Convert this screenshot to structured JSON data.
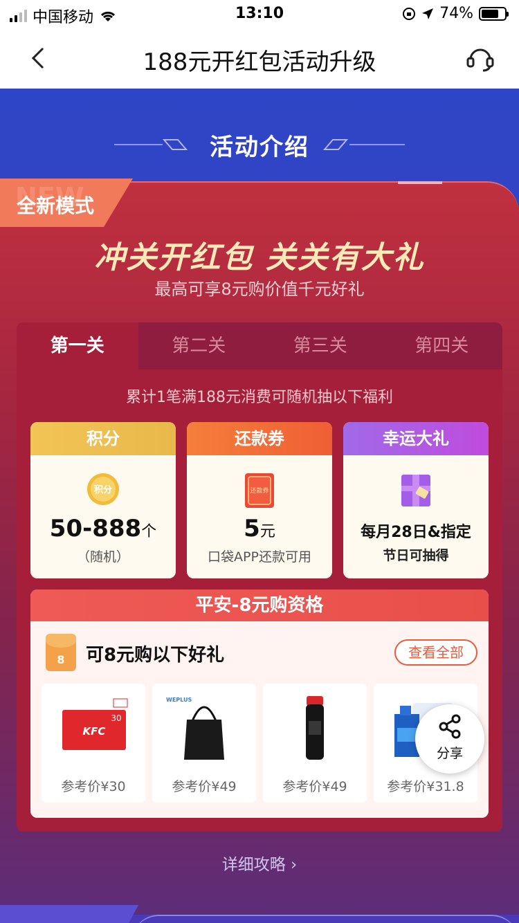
{
  "status_bar": {
    "carrier": "中国移动",
    "time": "13:10",
    "battery": "74%",
    "battery_level": 0.74
  },
  "nav": {
    "title": "188元开红包活动升级"
  },
  "section_title": "活动介绍",
  "tag": "全新模式",
  "headline": "冲关开红包 关关有大礼",
  "subline": "最高可享8元购价值千元好礼",
  "tabs": [
    "第一关",
    "第二关",
    "第三关",
    "第四关"
  ],
  "rule": "累计1笔满188元消费可随机抽以下福利",
  "benefits": [
    {
      "title": "积分",
      "value": "50-888",
      "unit": "个",
      "note": "（随机）",
      "icon": "points-coin-icon",
      "icon_text": "积分"
    },
    {
      "title": "还款券",
      "value": "5",
      "unit": "元",
      "note": "口袋APP还款可用",
      "icon": "repayment-coupon-icon",
      "icon_text": "还款券"
    },
    {
      "title": "幸运大礼",
      "value": "每月28日&指定",
      "note": "节日可抽得",
      "icon": "gift-box-icon"
    }
  ],
  "pingan": {
    "header": "平安-8元购资格",
    "title": "可8元购以下好礼",
    "view_all": "查看全部",
    "envelope_text": "8",
    "goods": [
      {
        "name": "kfc-card",
        "price": "参考价¥30",
        "img_text": "KFC",
        "img_value": "30"
      },
      {
        "name": "tote-bag",
        "price": "参考价¥49",
        "img_text": "WEPLUS"
      },
      {
        "name": "thermos-bottle",
        "price": "参考价¥49"
      },
      {
        "name": "detergent",
        "price": "参考价¥31.8"
      }
    ]
  },
  "share": {
    "label": "分享"
  },
  "detail_link": "详细攻略 ›",
  "colors": {
    "accent": "#ec5a3c",
    "background": "#2f45c7",
    "card": "#a61f3a"
  }
}
